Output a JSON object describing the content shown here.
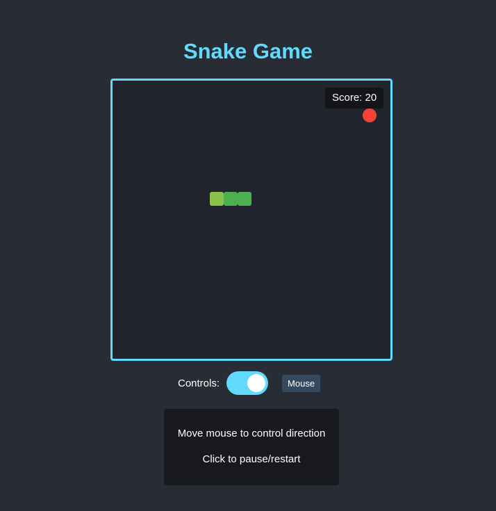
{
  "title": "Snake Game",
  "score_text": "Score: 20",
  "game": {
    "grid_columns": 20,
    "grid_rows": 20,
    "snake": [
      {
        "col": 7,
        "row": 8
      },
      {
        "col": 8,
        "row": 8
      },
      {
        "col": 9,
        "row": 8
      }
    ],
    "food": {
      "col": 18,
      "row": 2
    }
  },
  "controls": {
    "label": "Controls:",
    "toggle_on": true,
    "mode": "Mouse"
  },
  "instructions": [
    "Move mouse to control direction",
    "Click to pause/restart"
  ],
  "colors": {
    "accent": "#61dafb",
    "background": "#282c34",
    "board": "#21242c",
    "snake_head": "#8bc34a",
    "snake_body": "#4caf50",
    "food": "#f44336"
  }
}
